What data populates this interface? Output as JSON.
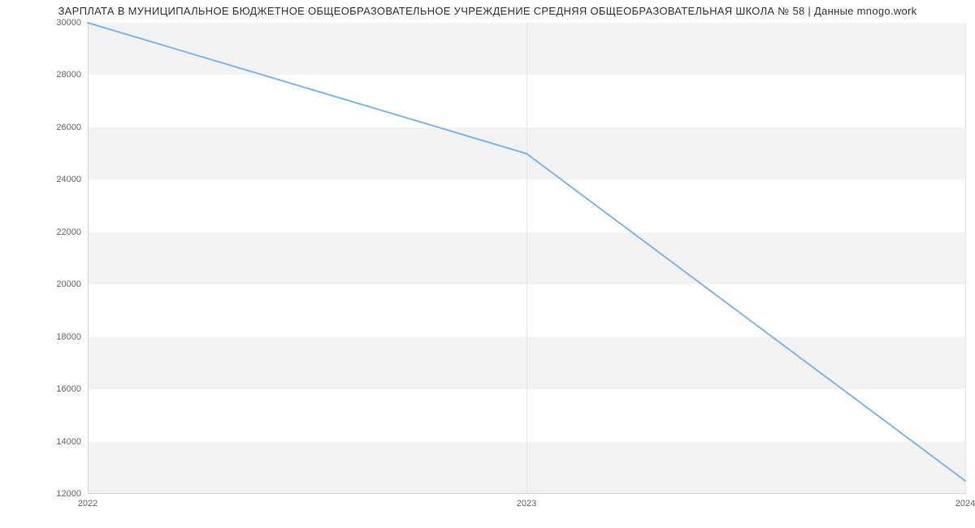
{
  "chart_data": {
    "type": "line",
    "title": "ЗАРПЛАТА В МУНИЦИПАЛЬНОЕ БЮДЖЕТНОЕ ОБЩЕОБРАЗОВАТЕЛЬНОЕ УЧРЕЖДЕНИЕ СРЕДНЯЯ ОБЩЕОБРАЗОВАТЕЛЬНАЯ ШКОЛА № 58 | Данные mnogo.work",
    "xlabel": "",
    "ylabel": "",
    "x": [
      2022,
      2023,
      2024
    ],
    "values": [
      30000,
      25000,
      12500
    ],
    "ylim": [
      12000,
      30000
    ],
    "y_ticks": [
      12000,
      14000,
      16000,
      18000,
      20000,
      22000,
      24000,
      26000,
      28000,
      30000
    ],
    "x_ticks": [
      2022,
      2023,
      2024
    ],
    "series_color": "#7cb5ec"
  }
}
